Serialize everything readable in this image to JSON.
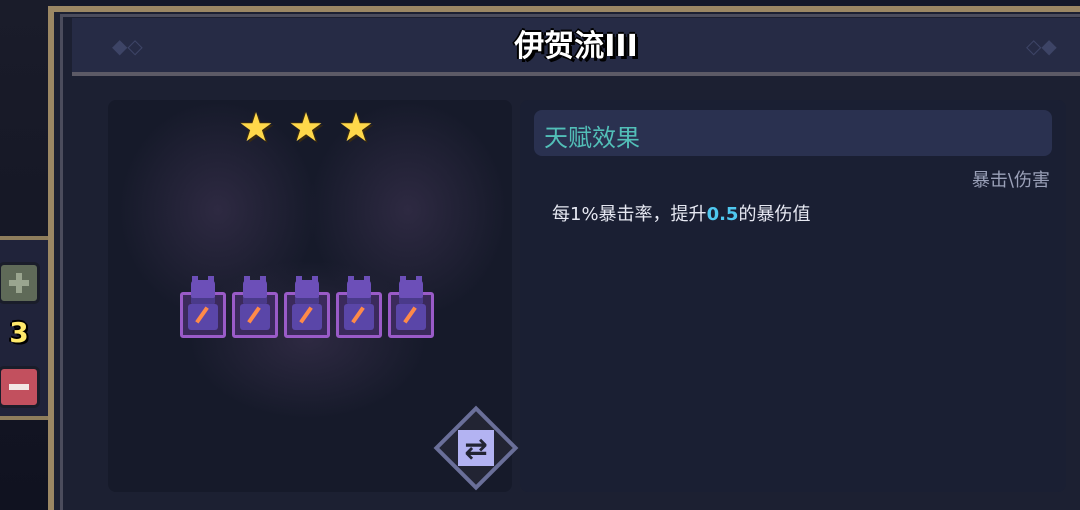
{
  "title": "伊贺流III",
  "stars": [
    "★",
    "★",
    "★"
  ],
  "counter": {
    "value": "3"
  },
  "units": [
    {
      "name": "ninja-unit"
    },
    {
      "name": "ninja-unit"
    },
    {
      "name": "ninja-unit"
    },
    {
      "name": "ninja-unit"
    },
    {
      "name": "ninja-unit"
    }
  ],
  "talent": {
    "header": "天赋效果",
    "tags": "暴击\\伤害",
    "desc_before": "每1%暴击率，提升",
    "desc_value": "0.5",
    "desc_after": "的暴伤值"
  },
  "colors": {
    "frame": "#9b8764",
    "accent_text": "#52bfb8",
    "highlight": "#4fc8f0",
    "star": "#ffd84a"
  },
  "icons": [
    "plus-icon",
    "minus-icon",
    "star-icon",
    "swap-icon",
    "ninja-unit-icon"
  ]
}
